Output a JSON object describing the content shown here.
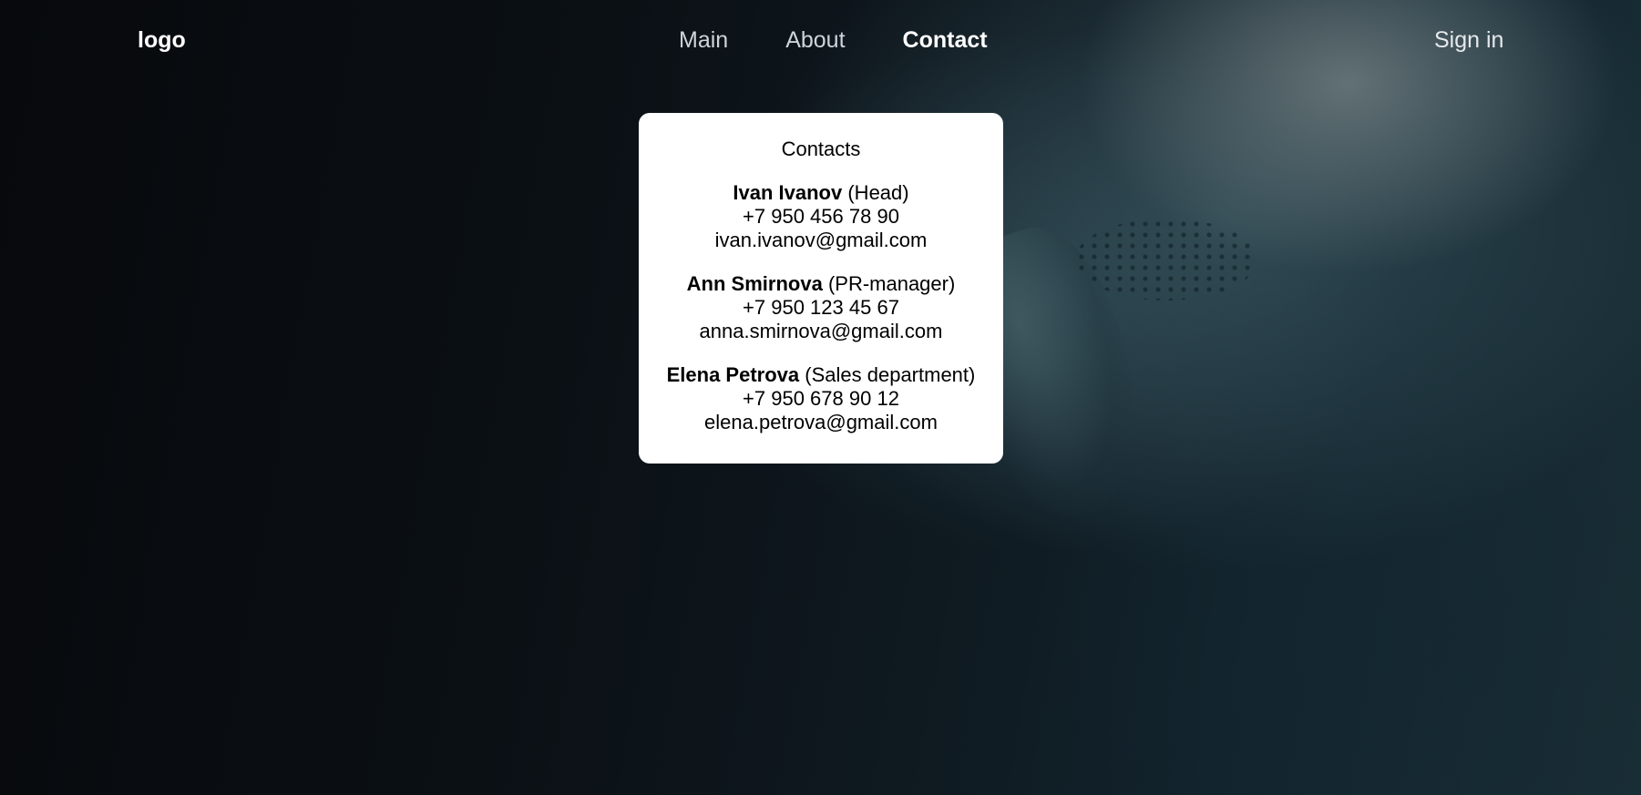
{
  "header": {
    "logo": "logo",
    "nav": [
      {
        "label": "Main",
        "active": false
      },
      {
        "label": "About",
        "active": false
      },
      {
        "label": "Contact",
        "active": true
      }
    ],
    "sign_in": "Sign in"
  },
  "contacts_card": {
    "title": "Contacts",
    "people": [
      {
        "name": "Ivan Ivanov",
        "role": "(Head)",
        "phone": "+7 950 456 78 90",
        "email": "ivan.ivanov@gmail.com"
      },
      {
        "name": "Ann Smirnova",
        "role": "(PR-manager)",
        "phone": "+7 950 123 45 67",
        "email": "anna.smirnova@gmail.com"
      },
      {
        "name": "Elena Petrova",
        "role": "(Sales department)",
        "phone": "+7 950 678 90 12",
        "email": "elena.petrova@gmail.com"
      }
    ]
  }
}
